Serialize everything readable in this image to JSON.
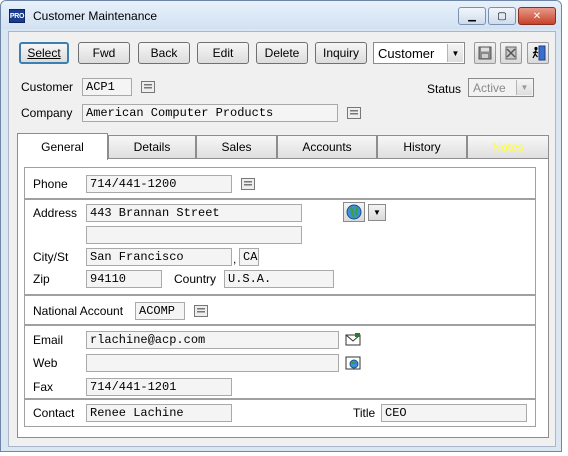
{
  "window": {
    "app_icon_text": "PRO",
    "title": "Customer Maintenance",
    "min_glyph": "▁",
    "max_glyph": "▢",
    "close_glyph": "✕"
  },
  "toolbar": {
    "select_label": "Select",
    "fwd_label": "Fwd",
    "back_label": "Back",
    "edit_label": "Edit",
    "delete_label": "Delete",
    "inquiry_label": "Inquiry",
    "mode_value": "Customer"
  },
  "header": {
    "customer_label": "Customer",
    "customer_value": "ACP1",
    "company_label": "Company",
    "company_value": "American Computer Products",
    "status_label": "Status",
    "status_value": "Active"
  },
  "tabs": [
    {
      "label": "General"
    },
    {
      "label": "Details"
    },
    {
      "label": "Sales"
    },
    {
      "label": "Accounts"
    },
    {
      "label": "History"
    },
    {
      "label": "Notes"
    }
  ],
  "general": {
    "phone_label": "Phone",
    "phone_value": "714/441-1200",
    "address_label": "Address",
    "address_line1": "443 Brannan Street",
    "address_line2": "",
    "city_label": "City/St",
    "city_value": "San Francisco",
    "city_sep": ",",
    "state_value": "CA",
    "zip_label": "Zip",
    "zip_value": "94110",
    "country_label": "Country",
    "country_value": "U.S.A.",
    "national_label": "National Account",
    "national_value": "ACOMP",
    "email_label": "Email",
    "email_value": "rlachine@acp.com",
    "web_label": "Web",
    "web_value": "",
    "fax_label": "Fax",
    "fax_value": "714/441-1201",
    "contact_label": "Contact",
    "contact_value": "Renee Lachine",
    "title_label": "Title",
    "title_value": "CEO"
  },
  "colors": {
    "accent": "#3c7fb1",
    "notes_tab_text": "#ffff33",
    "close_button": "#c7422a"
  },
  "icons": [
    "app-icon",
    "minimize-icon",
    "maximize-icon",
    "close-icon",
    "dropdown-arrow-icon",
    "save-icon",
    "delete-record-icon",
    "exit-icon",
    "lookup-icon",
    "globe-icon",
    "email-icon",
    "web-icon"
  ]
}
